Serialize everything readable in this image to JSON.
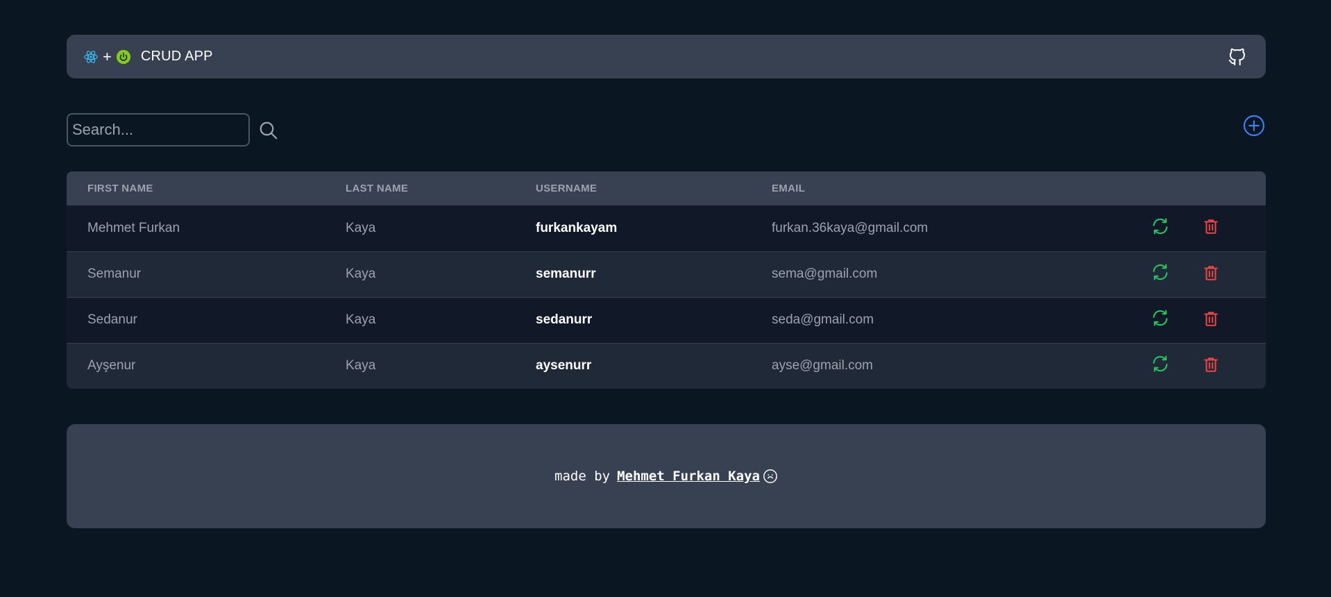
{
  "navbar": {
    "title": "CRUD APP",
    "plus": "+",
    "icons": [
      "react-icon",
      "spring-icon",
      "github-icon"
    ]
  },
  "search": {
    "placeholder": "Search...",
    "value": ""
  },
  "table": {
    "columns": [
      "FIRST NAME",
      "LAST NAME",
      "USERNAME",
      "EMAIL"
    ],
    "rows": [
      {
        "first_name": "Mehmet Furkan",
        "last_name": "Kaya",
        "username": "furkankayam",
        "email": "furkan.36kaya@gmail.com"
      },
      {
        "first_name": "Semanur",
        "last_name": "Kaya",
        "username": "semanurr",
        "email": "sema@gmail.com"
      },
      {
        "first_name": "Sedanur",
        "last_name": "Kaya",
        "username": "sedanurr",
        "email": "seda@gmail.com"
      },
      {
        "first_name": "Ayşenur",
        "last_name": "Kaya",
        "username": "aysenurr",
        "email": "ayse@gmail.com"
      }
    ]
  },
  "footer": {
    "prefix": "made by",
    "author": "Mehmet Furkan Kaya"
  },
  "colors": {
    "background": "#0b1623",
    "panel": "#374151",
    "update": "#22c55e",
    "delete": "#ef4444",
    "add": "#3b82f6"
  }
}
